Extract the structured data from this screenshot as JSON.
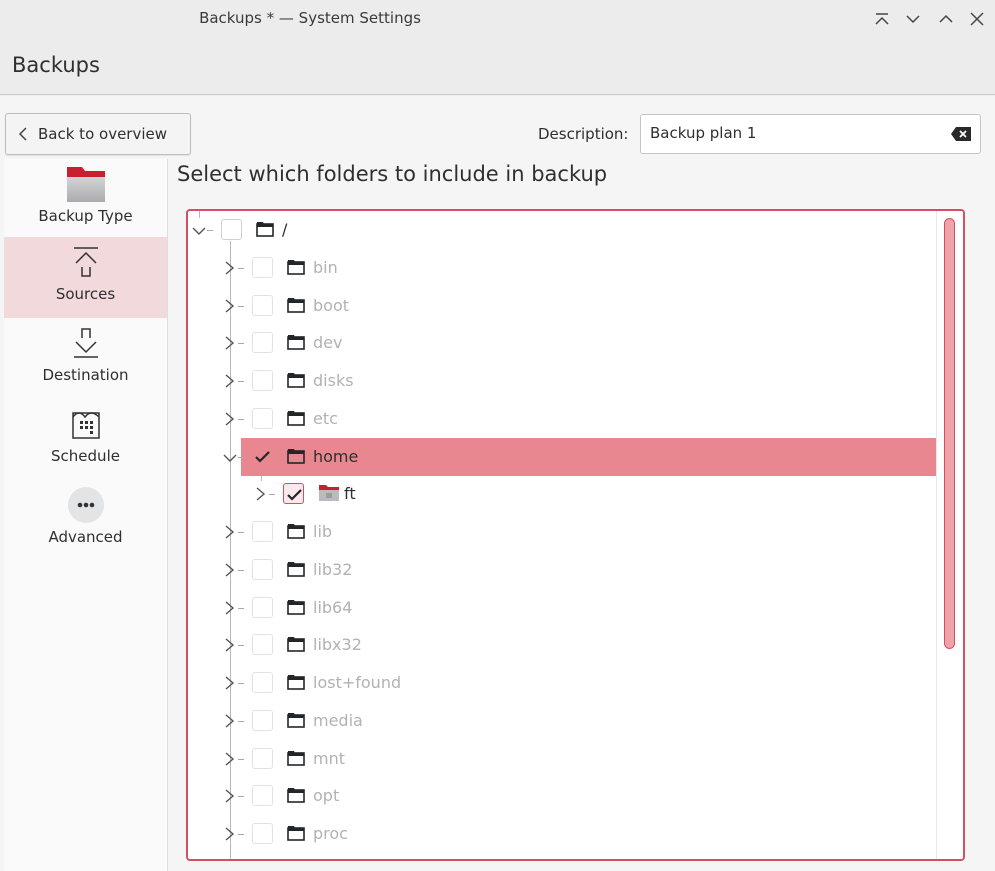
{
  "window": {
    "title": "Backups * — System Settings",
    "buttons": [
      "keep-above",
      "minimize",
      "maximize",
      "close"
    ]
  },
  "header": {
    "title": "Backups"
  },
  "toolbar": {
    "back_label": "Back to overview",
    "description_label": "Description:",
    "description_value": "Backup plan 1"
  },
  "sidebar": {
    "items": [
      {
        "label": "Backup Type",
        "icon": "folder-icon",
        "active": false
      },
      {
        "label": "Sources",
        "icon": "upload-icon",
        "active": true
      },
      {
        "label": "Destination",
        "icon": "download-icon",
        "active": false
      },
      {
        "label": "Schedule",
        "icon": "calendar-icon",
        "active": false
      },
      {
        "label": "Advanced",
        "icon": "more-icon",
        "active": false
      }
    ]
  },
  "main": {
    "section_title": "Select which folders to include in backup",
    "tree": [
      {
        "name": "/",
        "level": 0,
        "expanded": true,
        "checked": false,
        "selected": false,
        "enabled": true
      },
      {
        "name": "bin",
        "level": 1,
        "expanded": false,
        "checked": false,
        "selected": false,
        "enabled": false
      },
      {
        "name": "boot",
        "level": 1,
        "expanded": false,
        "checked": false,
        "selected": false,
        "enabled": false
      },
      {
        "name": "dev",
        "level": 1,
        "expanded": false,
        "checked": false,
        "selected": false,
        "enabled": false
      },
      {
        "name": "disks",
        "level": 1,
        "expanded": false,
        "checked": false,
        "selected": false,
        "enabled": false
      },
      {
        "name": "etc",
        "level": 1,
        "expanded": false,
        "checked": false,
        "selected": false,
        "enabled": false
      },
      {
        "name": "home",
        "level": 1,
        "expanded": true,
        "checked": true,
        "selected": true,
        "enabled": true
      },
      {
        "name": "ft",
        "level": 2,
        "expanded": false,
        "checked": true,
        "selected": false,
        "enabled": true,
        "icon": "user-home-folder-icon"
      },
      {
        "name": "lib",
        "level": 1,
        "expanded": false,
        "checked": false,
        "selected": false,
        "enabled": false
      },
      {
        "name": "lib32",
        "level": 1,
        "expanded": false,
        "checked": false,
        "selected": false,
        "enabled": false
      },
      {
        "name": "lib64",
        "level": 1,
        "expanded": false,
        "checked": false,
        "selected": false,
        "enabled": false
      },
      {
        "name": "libx32",
        "level": 1,
        "expanded": false,
        "checked": false,
        "selected": false,
        "enabled": false
      },
      {
        "name": "lost+found",
        "level": 1,
        "expanded": false,
        "checked": false,
        "selected": false,
        "enabled": false
      },
      {
        "name": "media",
        "level": 1,
        "expanded": false,
        "checked": false,
        "selected": false,
        "enabled": false
      },
      {
        "name": "mnt",
        "level": 1,
        "expanded": false,
        "checked": false,
        "selected": false,
        "enabled": false
      },
      {
        "name": "opt",
        "level": 1,
        "expanded": false,
        "checked": false,
        "selected": false,
        "enabled": false
      },
      {
        "name": "proc",
        "level": 1,
        "expanded": false,
        "checked": false,
        "selected": false,
        "enabled": false
      }
    ],
    "scroll_position": 0,
    "scroll_visible_fraction": 0.66
  },
  "colors": {
    "accent": "#d4505e",
    "selection": "#e8878f",
    "sidebar_active": "#f2d9dc"
  }
}
